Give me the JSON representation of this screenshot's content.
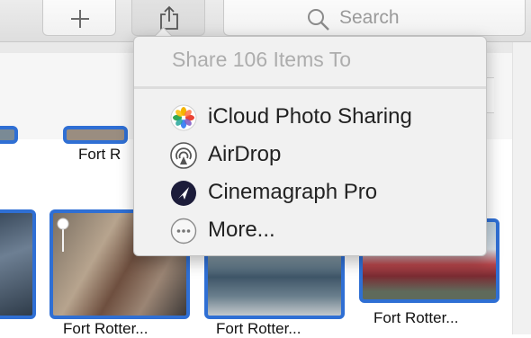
{
  "toolbar": {
    "add_icon": "plus-icon",
    "share_icon": "share-icon",
    "search": {
      "placeholder": "Search",
      "icon": "search-icon"
    }
  },
  "share_popover": {
    "title": "Share 106 Items To",
    "items": [
      {
        "label": "iCloud Photo Sharing",
        "icon": "photos-icon"
      },
      {
        "label": "AirDrop",
        "icon": "airdrop-icon"
      },
      {
        "label": "Cinemagraph Pro",
        "icon": "cinemagraph-icon"
      },
      {
        "label": "More...",
        "icon": "more-icon"
      }
    ]
  },
  "photos": {
    "captions": [
      "Fort R",
      "Fort Rotter...",
      "Fort Rotter...",
      "Fort Rotter..."
    ]
  },
  "colors": {
    "selection": "#2f6fd4",
    "popover_bg": "#f1f1f1"
  }
}
